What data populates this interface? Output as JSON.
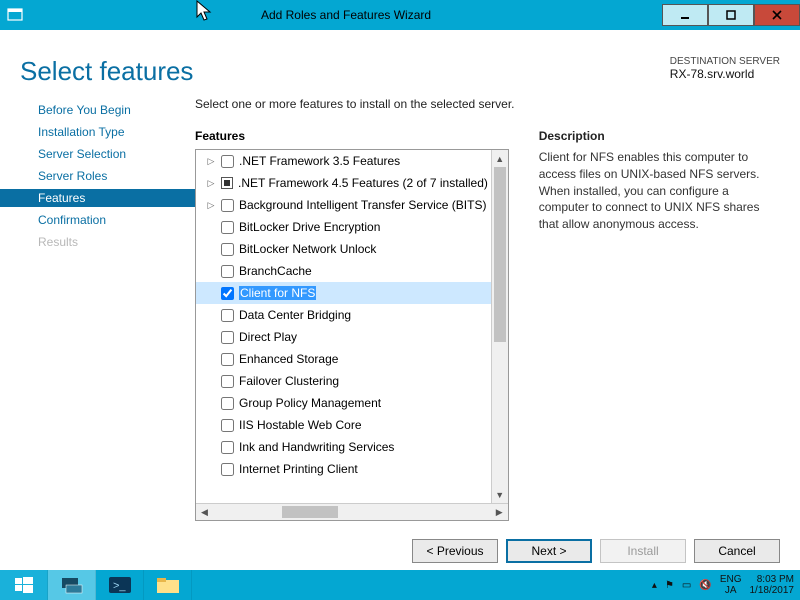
{
  "titlebar": {
    "title": "Add Roles and Features Wizard"
  },
  "header": {
    "heading": "Select features",
    "dest_label": "DESTINATION SERVER",
    "dest_server": "RX-78.srv.world"
  },
  "steps": [
    {
      "label": "Before You Begin",
      "state": "done"
    },
    {
      "label": "Installation Type",
      "state": "done"
    },
    {
      "label": "Server Selection",
      "state": "done"
    },
    {
      "label": "Server Roles",
      "state": "done"
    },
    {
      "label": "Features",
      "state": "active"
    },
    {
      "label": "Confirmation",
      "state": "done"
    },
    {
      "label": "Results",
      "state": "disabled"
    }
  ],
  "instruction": "Select one or more features to install on the selected server.",
  "features_title": "Features",
  "features": [
    {
      "label": ".NET Framework 3.5 Features",
      "expandable": true,
      "check": "unchecked"
    },
    {
      "label": ".NET Framework 4.5 Features (2 of 7 installed)",
      "expandable": true,
      "check": "partial"
    },
    {
      "label": "Background Intelligent Transfer Service (BITS)",
      "expandable": true,
      "check": "unchecked"
    },
    {
      "label": "BitLocker Drive Encryption",
      "expandable": false,
      "check": "unchecked"
    },
    {
      "label": "BitLocker Network Unlock",
      "expandable": false,
      "check": "unchecked"
    },
    {
      "label": "BranchCache",
      "expandable": false,
      "check": "unchecked"
    },
    {
      "label": "Client for NFS",
      "expandable": false,
      "check": "checked",
      "selected": true
    },
    {
      "label": "Data Center Bridging",
      "expandable": false,
      "check": "unchecked"
    },
    {
      "label": "Direct Play",
      "expandable": false,
      "check": "unchecked"
    },
    {
      "label": "Enhanced Storage",
      "expandable": false,
      "check": "unchecked"
    },
    {
      "label": "Failover Clustering",
      "expandable": false,
      "check": "unchecked"
    },
    {
      "label": "Group Policy Management",
      "expandable": false,
      "check": "unchecked"
    },
    {
      "label": "IIS Hostable Web Core",
      "expandable": false,
      "check": "unchecked"
    },
    {
      "label": "Ink and Handwriting Services",
      "expandable": false,
      "check": "unchecked"
    },
    {
      "label": "Internet Printing Client",
      "expandable": false,
      "check": "unchecked"
    }
  ],
  "description_title": "Description",
  "description_body": "Client for NFS enables this computer to access files on UNIX-based NFS servers. When installed, you can configure a computer to connect to UNIX NFS shares that allow anonymous access.",
  "buttons": {
    "previous": "< Previous",
    "next": "Next >",
    "install": "Install",
    "cancel": "Cancel"
  },
  "tray": {
    "lang1": "ENG",
    "lang2": "JA",
    "time": "8:03 PM",
    "date": "1/18/2017"
  }
}
